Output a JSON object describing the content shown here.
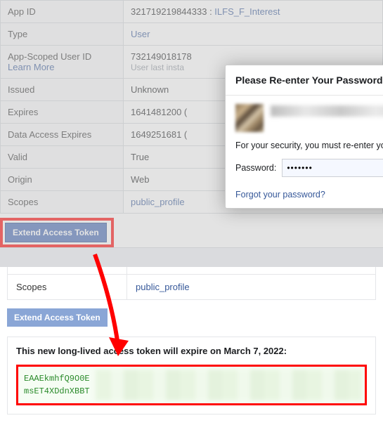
{
  "top_table": {
    "rows": [
      {
        "label": "App ID",
        "value_num": "321719219844333",
        "sep": " : ",
        "value_link": "ILFS_F_Interest"
      },
      {
        "label": "Type",
        "value_link": "User"
      },
      {
        "label": "App-Scoped User ID",
        "label_extra_link": "Learn More",
        "value_num": "732149018178",
        "value_sub": "User last insta"
      },
      {
        "label": "Issued",
        "value": "Unknown"
      },
      {
        "label": "Expires",
        "value": "1641481200 ("
      },
      {
        "label": "Data Access Expires",
        "value": "1649251681 ("
      },
      {
        "label": "Valid",
        "value": "True"
      },
      {
        "label": "Origin",
        "value": "Web"
      },
      {
        "label": "Scopes",
        "value_link": "public_profile"
      }
    ],
    "extend_btn": "Extend Access Token"
  },
  "dialog": {
    "title": "Please Re-enter Your Password",
    "security_text": "For your security, you must re-enter you",
    "password_label": "Password:",
    "password_value": "•••••••",
    "forgot": "Forgot your password?"
  },
  "lower": {
    "scopes_label": "Scopes",
    "scopes_value": "public_profile",
    "extend_btn": "Extend Access Token",
    "result_title": "This new long-lived access token will expire on March 7, 2022:",
    "token_line1": "EAAEkmhfQ9O0E",
    "token_line2": "msET4XDdnXBBT"
  },
  "colors": {
    "red": "#ff0000",
    "link": "#365899",
    "btn": "#4367b3"
  }
}
